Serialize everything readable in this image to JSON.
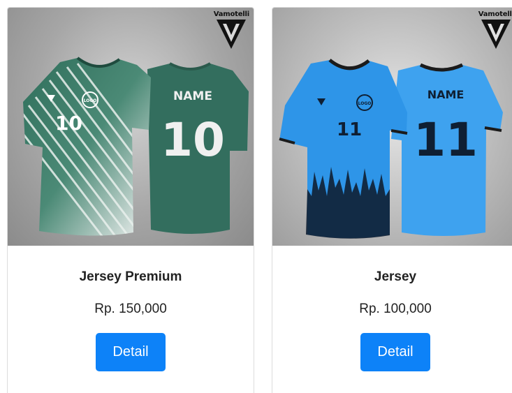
{
  "products": [
    {
      "title": "Jersey Premium",
      "price": "Rp. 150,000",
      "button_label": "Detail",
      "brand": "Vamotelli",
      "jersey_number": "10",
      "jersey_name": "NAME",
      "jersey_logo": "LOGO",
      "primary_color": "#2f6e5b"
    },
    {
      "title": "Jersey",
      "price": "Rp. 100,000",
      "button_label": "Detail",
      "brand": "Vamotelli",
      "jersey_number": "11",
      "jersey_name": "NAME",
      "jersey_logo": "LOGO",
      "primary_color": "#2e95e8"
    }
  ],
  "colors": {
    "button": "#0d82f8",
    "button_text": "#ffffff",
    "text": "#222222"
  }
}
